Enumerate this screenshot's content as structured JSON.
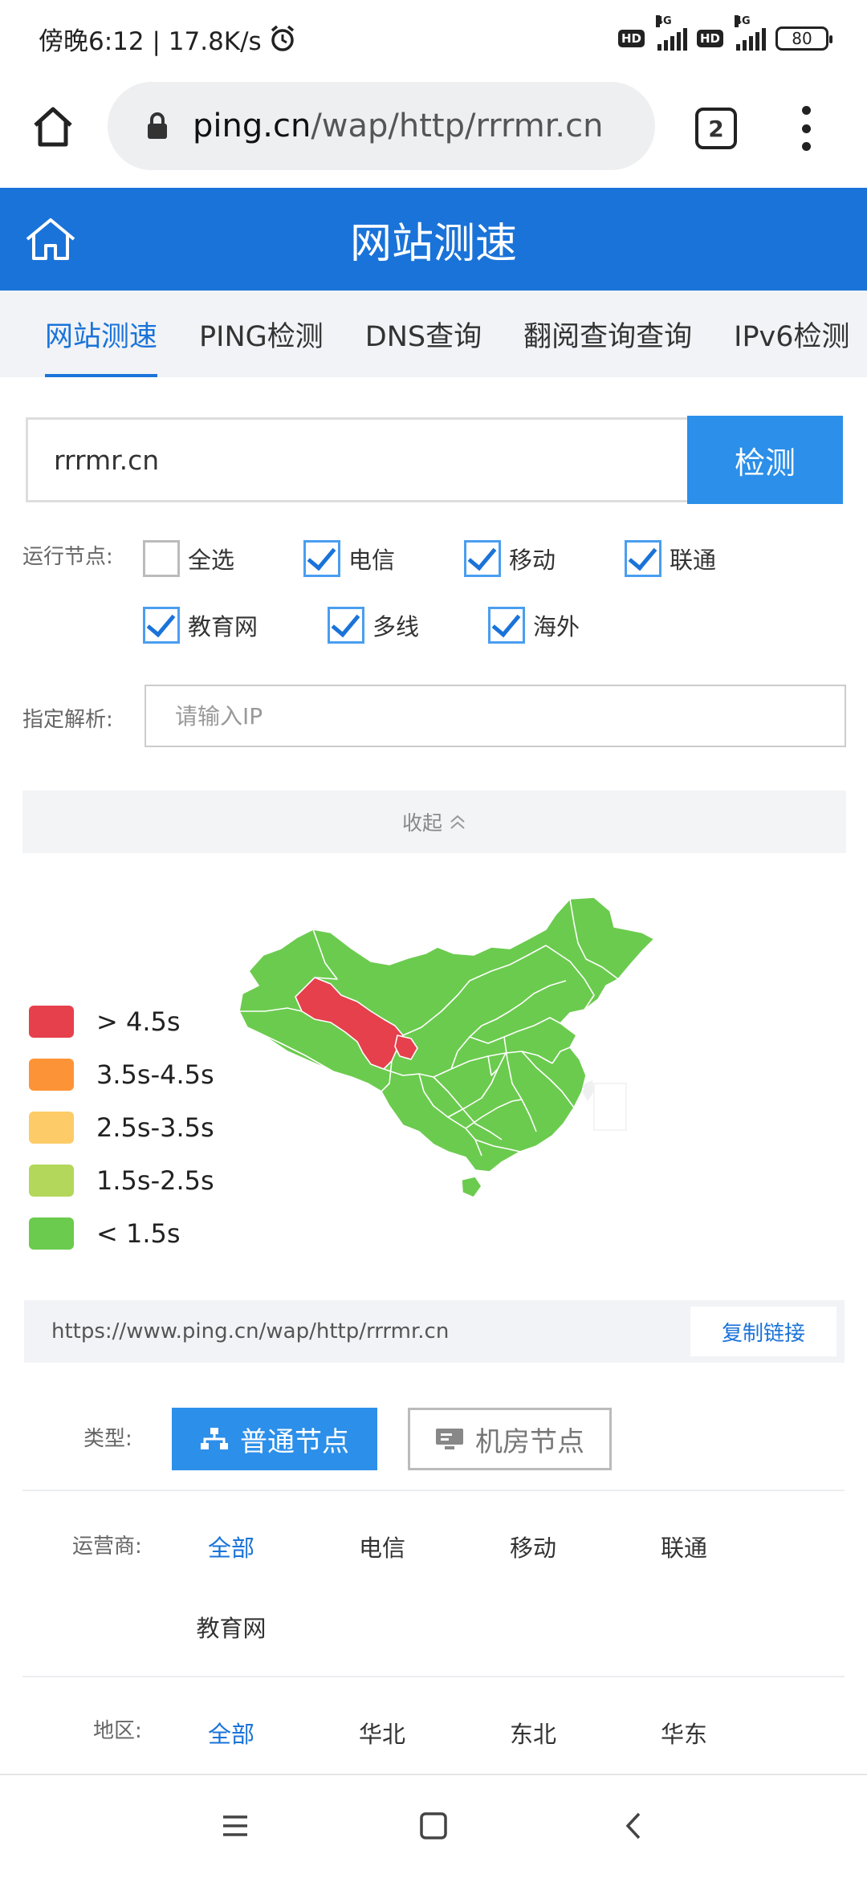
{
  "status_bar": {
    "time_speed": "傍晚6:12 | 17.8K/s",
    "network_1": "4G",
    "network_2": "4G",
    "hd_1": "HD",
    "hd_2": "HD",
    "battery": "80"
  },
  "browser": {
    "url_host": "ping.cn",
    "url_path": "/wap/http/rrrmr.cn",
    "tab_count": "2"
  },
  "header": {
    "title": "网站测速"
  },
  "tabs": [
    {
      "label": "网站测速",
      "active": true
    },
    {
      "label": "PING检测",
      "active": false
    },
    {
      "label": "DNS查询",
      "active": false
    },
    {
      "label": "翻阅查询查询",
      "active": false
    },
    {
      "label": "IPv6检测",
      "active": false
    }
  ],
  "search": {
    "value": "rrrmr.cn",
    "button_label": "检测"
  },
  "nodes": {
    "label": "运行节点:",
    "options": [
      {
        "label": "全选",
        "checked": false
      },
      {
        "label": "电信",
        "checked": true
      },
      {
        "label": "移动",
        "checked": true
      },
      {
        "label": "联通",
        "checked": true
      },
      {
        "label": "教育网",
        "checked": true
      },
      {
        "label": "多线",
        "checked": true
      },
      {
        "label": "海外",
        "checked": true
      }
    ]
  },
  "resolve": {
    "label": "指定解析:",
    "placeholder": "请输入IP"
  },
  "collapse": {
    "label": "收起"
  },
  "legend": [
    {
      "label": "> 4.5s",
      "color": "#e5404c"
    },
    {
      "label": "3.5s-4.5s",
      "color": "#fd9337"
    },
    {
      "label": "2.5s-3.5s",
      "color": "#fdcb67"
    },
    {
      "label": "1.5s-2.5s",
      "color": "#b3d75a"
    },
    {
      "label": "< 1.5s",
      "color": "#6bcb4e"
    }
  ],
  "map": {
    "slow_regions": [
      "Gansu",
      "Ningxia"
    ],
    "slow_color": "#e5404c",
    "fast_color": "#6bcb4e"
  },
  "share": {
    "url": "https://www.ping.cn/wap/http/rrrmr.cn",
    "copy_label": "复制链接"
  },
  "type": {
    "label": "类型:",
    "normal_label": "普通节点",
    "datacenter_label": "机房节点"
  },
  "isp": {
    "label": "运营商:",
    "options": [
      "全部",
      "电信",
      "移动",
      "联通",
      "教育网"
    ]
  },
  "region": {
    "label": "地区:",
    "options": [
      "全部",
      "华北",
      "东北",
      "华东"
    ]
  }
}
